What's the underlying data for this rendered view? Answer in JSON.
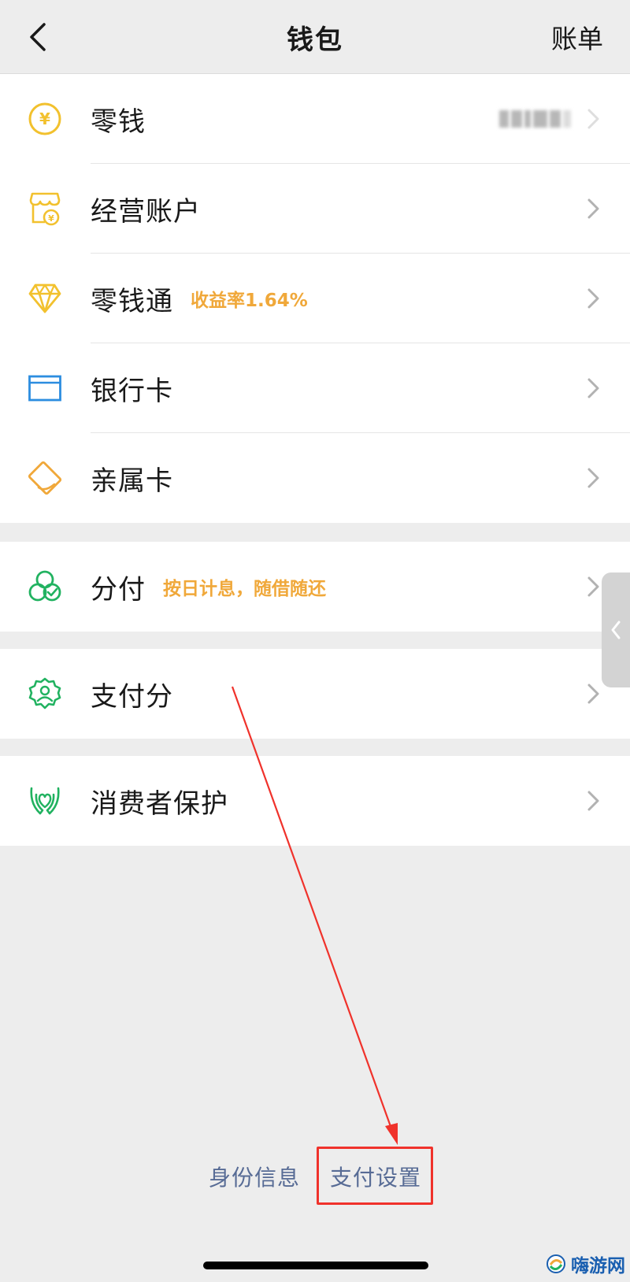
{
  "nav": {
    "title": "钱包",
    "right": "账单"
  },
  "groups": [
    {
      "items": [
        {
          "label": "零钱",
          "icon": "yuan-coin-icon",
          "has_balance": true
        },
        {
          "label": "经营账户",
          "icon": "shop-account-icon"
        },
        {
          "label": "零钱通",
          "icon": "diamond-icon",
          "tag": "收益率1.64%"
        },
        {
          "label": "银行卡",
          "icon": "bank-card-icon"
        },
        {
          "label": "亲属卡",
          "icon": "family-card-icon"
        }
      ]
    },
    {
      "items": [
        {
          "label": "分付",
          "icon": "installment-icon",
          "tag": "按日计息，随借随还"
        }
      ]
    },
    {
      "items": [
        {
          "label": "支付分",
          "icon": "pay-score-icon"
        }
      ]
    },
    {
      "items": [
        {
          "label": "消费者保护",
          "icon": "consumer-protection-icon"
        }
      ]
    }
  ],
  "footer": {
    "identity": "身份信息",
    "pay_settings": "支付设置"
  },
  "watermark": {
    "text": "嗨游网"
  },
  "colors": {
    "gold": "#f2c12e",
    "orange": "#f0a83a",
    "blue": "#2c8de0",
    "green": "#21b260",
    "link": "#576b95",
    "highlight": "#f0322b"
  }
}
